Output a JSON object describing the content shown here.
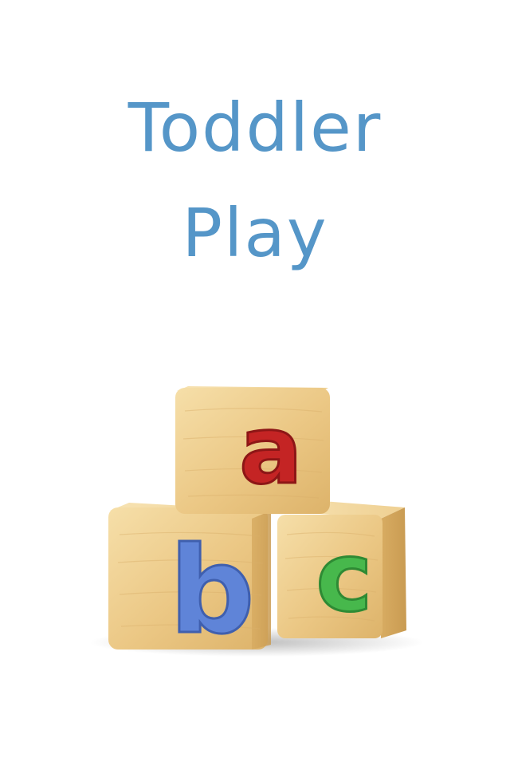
{
  "splash": {
    "title_line_1": "Toddler",
    "title_line_2": "Play"
  },
  "blocks": [
    {
      "letter": "a",
      "name": "block-a",
      "color": "#c42424"
    },
    {
      "letter": "b",
      "name": "block-b",
      "color": "#5f84d8"
    },
    {
      "letter": "c",
      "name": "block-c",
      "color": "#47b84c"
    }
  ],
  "colors": {
    "title": "#5596c8",
    "background": "#ffffff",
    "wood_light": "#f3d9a0",
    "wood_mid": "#e3b96d",
    "wood_dark": "#c99b52"
  }
}
